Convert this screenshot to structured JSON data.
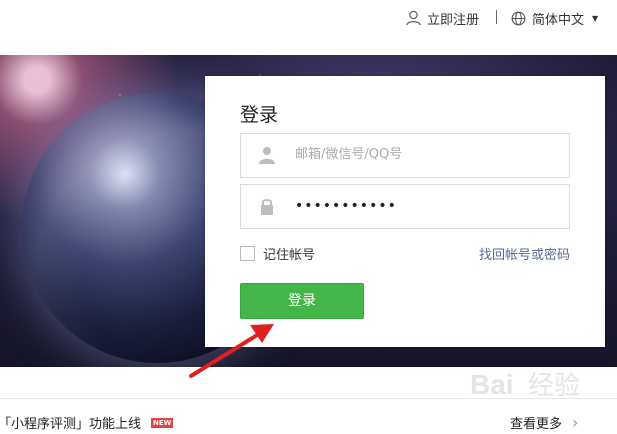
{
  "topbar": {
    "register_label": "立即注册",
    "language_label": "简体中文",
    "user_icon": "user-icon",
    "globe_icon": "globe-icon"
  },
  "login": {
    "title": "登录",
    "account_placeholder": "邮箱/微信号/QQ号",
    "password_value": "•••••••••••",
    "remember_label": "记住帐号",
    "forgot_label": "找回帐号或密码",
    "submit_label": "登录"
  },
  "bottom": {
    "notice_text": "「小程序评测」功能上线",
    "notice_badge": "NEW",
    "more_label": "查看更多"
  },
  "watermark": {
    "text": "Bai经验"
  },
  "colors": {
    "primary_green": "#44b549",
    "link_blue": "#576b95",
    "badge_red": "#e64340",
    "arrow_red": "#e02020"
  }
}
